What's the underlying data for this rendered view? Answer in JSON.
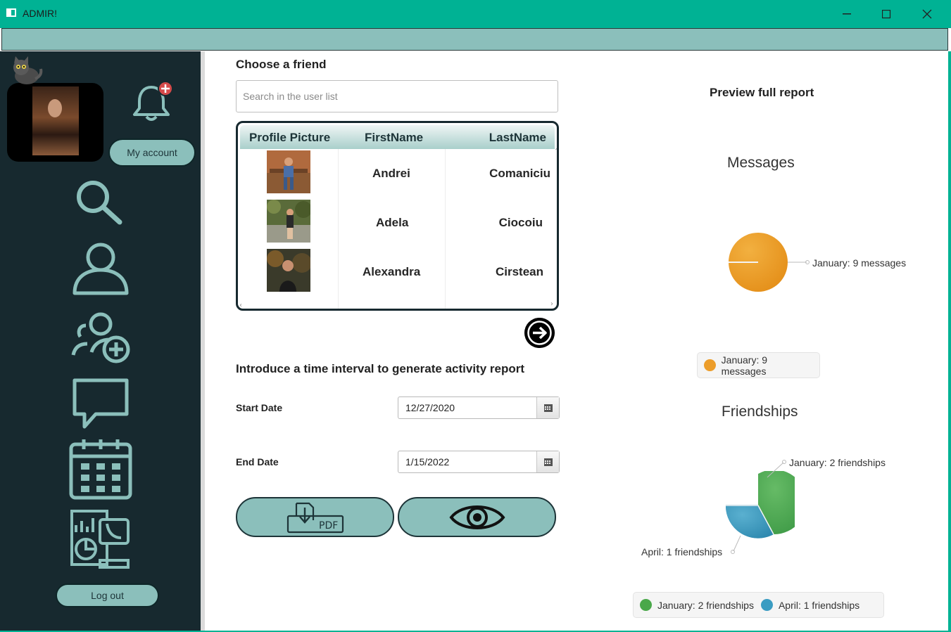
{
  "window": {
    "title": "ADMIR!"
  },
  "sidebar": {
    "my_account": "My account",
    "log_out": "Log out"
  },
  "main": {
    "choose_friend": "Choose a friend",
    "search_placeholder": "Search in the user list",
    "table": {
      "columns": [
        "Profile Picture",
        "FirstName",
        "LastName"
      ],
      "rows": [
        {
          "first": "Andrei",
          "last": "Comaniciu"
        },
        {
          "first": "Adela",
          "last": "Ciocoiu"
        },
        {
          "first": "Alexandra",
          "last": "Cirstean"
        }
      ]
    },
    "interval_label": "Introduce a time interval to generate activity report",
    "start_label": "Start Date",
    "start_value": "12/27/2020",
    "end_label": "End Date",
    "end_value": "1/15/2022",
    "pdf_label": "PDF"
  },
  "report": {
    "preview_title": "Preview full report",
    "colors": {
      "orange": "#ec9d2a",
      "green": "#4aa84a",
      "blue": "#3a9cc2",
      "accent": "#8bbfbb",
      "sidebar": "#17292f",
      "titlebar": "#00b294"
    },
    "messages": {
      "title": "Messages",
      "slice_label": "January: 9 messages",
      "legend": [
        "January: 9 messages"
      ]
    },
    "friendships": {
      "title": "Friendships",
      "label_jan": "January: 2 friendships",
      "label_apr": "April: 1 friendships",
      "legend": [
        "January: 2 friendships",
        "April: 1 friendships"
      ]
    }
  },
  "chart_data": [
    {
      "type": "pie",
      "title": "Messages",
      "categories": [
        "January"
      ],
      "values": [
        9
      ]
    },
    {
      "type": "pie",
      "title": "Friendships",
      "categories": [
        "January",
        "April"
      ],
      "values": [
        2,
        1
      ]
    }
  ]
}
